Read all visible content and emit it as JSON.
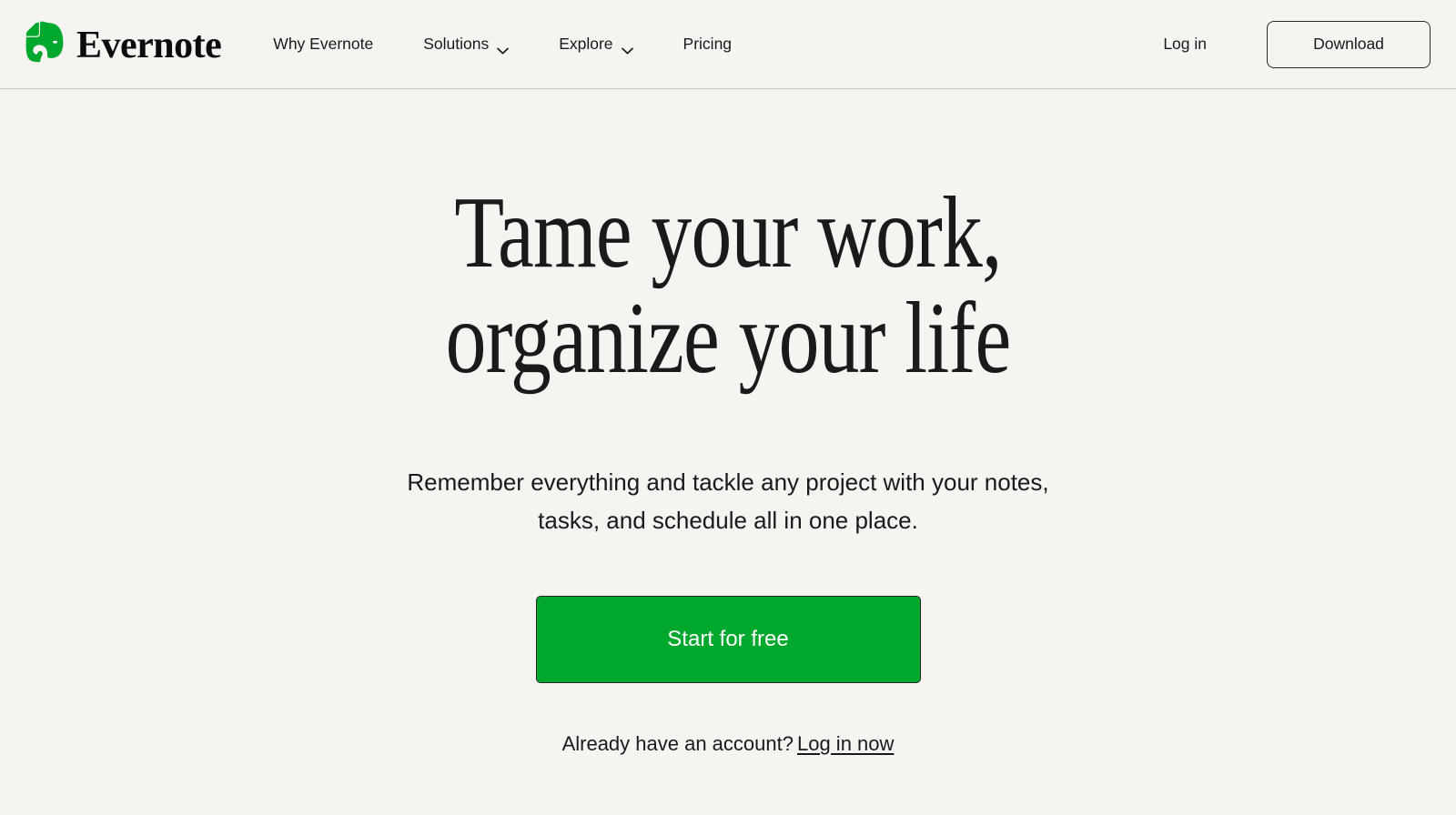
{
  "theme": {
    "background": "#F5F4F0",
    "text": "#1A1A1A",
    "brand_green": "#00A82D",
    "border": "#2B2B2B",
    "header_rule": "#C9C7C1"
  },
  "header": {
    "brand": {
      "logo_icon": "evernote-elephant-icon",
      "wordmark": "Evernote"
    },
    "nav": [
      {
        "label": "Why Evernote",
        "has_dropdown": false
      },
      {
        "label": "Solutions",
        "has_dropdown": true,
        "icon": "chevron-down-icon"
      },
      {
        "label": "Explore",
        "has_dropdown": true,
        "icon": "chevron-down-icon"
      },
      {
        "label": "Pricing",
        "has_dropdown": false
      }
    ],
    "login_label": "Log in",
    "download_label": "Download"
  },
  "hero": {
    "title_line1": "Tame your work,",
    "title_line2": "organize your life",
    "subtitle_line1": "Remember everything and tackle any project with your notes,",
    "subtitle_line2": "tasks, and schedule all in one place.",
    "cta_label": "Start for free",
    "account_prompt": "Already have an account?",
    "account_link": "Log in now"
  }
}
